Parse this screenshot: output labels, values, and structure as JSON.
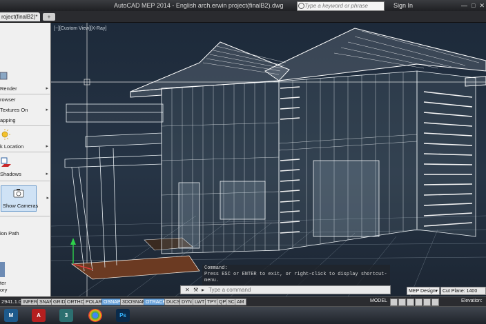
{
  "window": {
    "title": "AutoCAD MEP 2014 - English   arch.erwin project(finalB2).dwg"
  },
  "search": {
    "placeholder": "Type a keyword or phrase"
  },
  "account": {
    "signin_label": "Sign In"
  },
  "tabs": [
    {
      "label": "roject(finalB2)*"
    }
  ],
  "left_panel": {
    "items": [
      {
        "label": "Render"
      },
      {
        "label": "rowser"
      },
      {
        "label": "Textures On"
      },
      {
        "label": "apping"
      },
      {
        "label": "k Location"
      },
      {
        "label": "Shadows"
      },
      {
        "label": "Show Cameras"
      },
      {
        "label": "ion Path"
      },
      {
        "label": "ter"
      },
      {
        "label": "ory"
      }
    ]
  },
  "viewport": {
    "label": "[−][Custom View][X-Ray]"
  },
  "command": {
    "history": [
      "Command:",
      "Press ESC or ENTER to exit, or right-click to display shortcut-",
      "menu."
    ],
    "placeholder": "Type a command"
  },
  "mep": {
    "design_label": "MEP Design",
    "cut_plane_label": "Cut Plane:",
    "cut_plane_value": "1400"
  },
  "status": {
    "coords": "2941.1.0",
    "buttons": [
      {
        "label": "INFER",
        "on": false
      },
      {
        "label": "SNAP",
        "on": false
      },
      {
        "label": "GRID",
        "on": false
      },
      {
        "label": "ORTHO",
        "on": false
      },
      {
        "label": "POLAR",
        "on": false
      },
      {
        "label": "OSNAP",
        "on": true
      },
      {
        "label": "3DOSNAP",
        "on": false
      },
      {
        "label": "OTRACK",
        "on": true
      },
      {
        "label": "DUCS",
        "on": false
      },
      {
        "label": "DYN",
        "on": false
      },
      {
        "label": "LWT",
        "on": false
      },
      {
        "label": "TPY",
        "on": false
      },
      {
        "label": "QP",
        "on": false
      },
      {
        "label": "SC",
        "on": false
      },
      {
        "label": "AM",
        "on": false
      }
    ],
    "model_label": "MODEL",
    "elevation_label": "Elevation:"
  },
  "taskbar": {
    "apps": [
      {
        "name": "autocad-mep-app",
        "label": "M"
      },
      {
        "name": "autocad-app",
        "label": "A"
      },
      {
        "name": "3dsmax-app",
        "label": "3"
      },
      {
        "name": "chrome-app",
        "label": ""
      },
      {
        "name": "photoshop-app",
        "label": "Ps"
      }
    ]
  },
  "colors": {
    "accent_on": "#6fa6dc",
    "viewport_bg": "#263445",
    "wire": "#e8eef2"
  }
}
